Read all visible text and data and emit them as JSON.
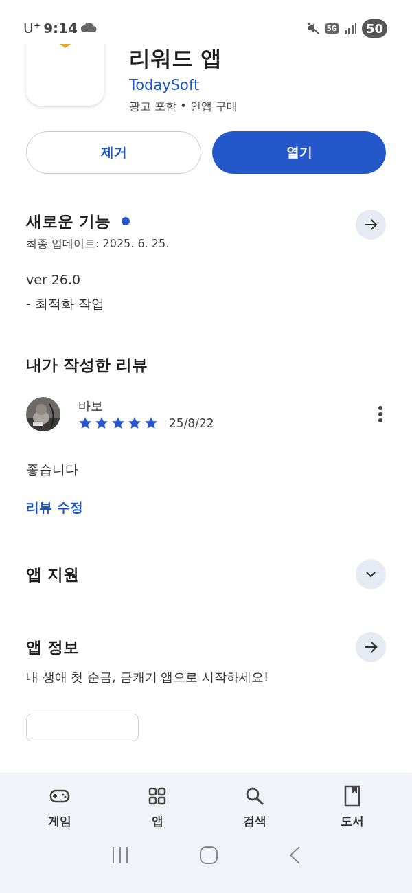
{
  "status_bar": {
    "carrier": "U⁺",
    "time": "9:14",
    "network": "5G",
    "battery": "50"
  },
  "app": {
    "title": "리워드 앱",
    "developer": "TodaySoft",
    "notes": "광고 포함 • 인앱 구매"
  },
  "buttons": [
    {
      "label": "제거",
      "kind": "outline"
    },
    {
      "label": "열기",
      "kind": "filled"
    }
  ],
  "whats_new": {
    "title": "새로운 기능",
    "updated": "최종 업데이트: 2025. 6. 25.",
    "new_dot": true,
    "lines": [
      "ver 26.0",
      "- 최적화 작업"
    ]
  },
  "my_review": {
    "title": "내가 작성한 리뷰",
    "author": "바보",
    "stars": 5,
    "date": "25/8/22",
    "text": "좋습니다",
    "edit_link": "리뷰 수정"
  },
  "app_support": {
    "title": "앱 지원",
    "expanded": false
  },
  "app_info": {
    "title": "앱 정보",
    "description": "내 생애 첫 순금, 금캐기 앱으로 시작하세요!"
  },
  "bottom_nav": [
    {
      "label": "게임",
      "kind": "games"
    },
    {
      "label": "앱",
      "kind": "apps"
    },
    {
      "label": "검색",
      "kind": "search"
    },
    {
      "label": "도서",
      "kind": "books"
    }
  ]
}
